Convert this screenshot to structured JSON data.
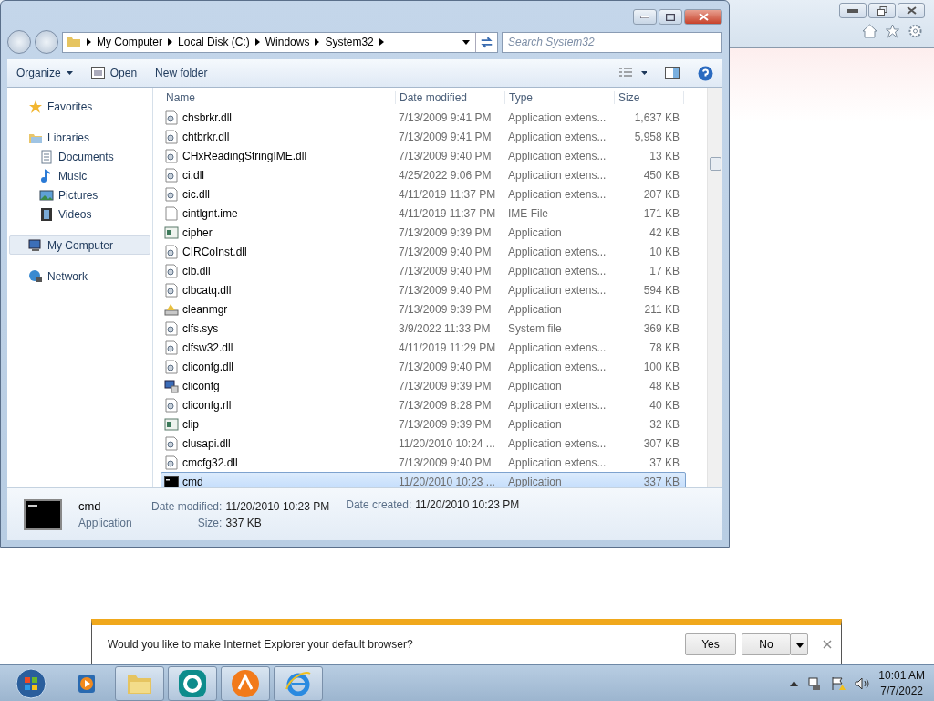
{
  "explorer": {
    "breadcrumbs": [
      "My Computer",
      "Local Disk (C:)",
      "Windows",
      "System32"
    ],
    "search": {
      "placeholder": "Search System32"
    },
    "toolbar": [
      {
        "label": "Organize",
        "kind": "menu"
      },
      {
        "label": "Open",
        "kind": "open"
      },
      {
        "label": "New folder",
        "kind": "plain"
      }
    ],
    "nav": [
      {
        "label": "Favorites",
        "kind": "star",
        "selected": false
      },
      {
        "label": "Libraries",
        "kind": "library",
        "selected": false,
        "children": [
          {
            "label": "Documents",
            "kind": "document",
            "selected": false
          },
          {
            "label": "Music",
            "kind": "music",
            "selected": false
          },
          {
            "label": "Pictures",
            "kind": "pictures",
            "selected": false
          },
          {
            "label": "Videos",
            "kind": "videos",
            "selected": false
          }
        ]
      },
      {
        "label": "My Computer",
        "kind": "computer",
        "selected": true
      },
      {
        "label": "Network",
        "kind": "network",
        "selected": false
      }
    ],
    "columns": [
      "Name",
      "Date modified",
      "Type",
      "Size"
    ],
    "rows": [
      {
        "name": "chsbrkr.dll",
        "date": "7/13/2009 9:41 PM",
        "type": "Application extens...",
        "size": "1,637 KB",
        "kind": "dll",
        "selected": false
      },
      {
        "name": "chtbrkr.dll",
        "date": "7/13/2009 9:41 PM",
        "type": "Application extens...",
        "size": "5,958 KB",
        "kind": "dll",
        "selected": false
      },
      {
        "name": "CHxReadingStringIME.dll",
        "date": "7/13/2009 9:40 PM",
        "type": "Application extens...",
        "size": "13 KB",
        "kind": "dll",
        "selected": false
      },
      {
        "name": "ci.dll",
        "date": "4/25/2022 9:06 PM",
        "type": "Application extens...",
        "size": "450 KB",
        "kind": "dll",
        "selected": false
      },
      {
        "name": "cic.dll",
        "date": "4/11/2019 11:37 PM",
        "type": "Application extens...",
        "size": "207 KB",
        "kind": "dll",
        "selected": false
      },
      {
        "name": "cintlgnt.ime",
        "date": "4/11/2019 11:37 PM",
        "type": "IME File",
        "size": "171 KB",
        "kind": "file",
        "selected": false
      },
      {
        "name": "cipher",
        "date": "7/13/2009 9:39 PM",
        "type": "Application",
        "size": "42 KB",
        "kind": "app",
        "selected": false
      },
      {
        "name": "CIRCoInst.dll",
        "date": "7/13/2009 9:40 PM",
        "type": "Application extens...",
        "size": "10 KB",
        "kind": "dll",
        "selected": false
      },
      {
        "name": "clb.dll",
        "date": "7/13/2009 9:40 PM",
        "type": "Application extens...",
        "size": "17 KB",
        "kind": "dll",
        "selected": false
      },
      {
        "name": "clbcatq.dll",
        "date": "7/13/2009 9:40 PM",
        "type": "Application extens...",
        "size": "594 KB",
        "kind": "dll",
        "selected": false
      },
      {
        "name": "cleanmgr",
        "date": "7/13/2009 9:39 PM",
        "type": "Application",
        "size": "211 KB",
        "kind": "cleaner",
        "selected": false
      },
      {
        "name": "clfs.sys",
        "date": "3/9/2022 11:33 PM",
        "type": "System file",
        "size": "369 KB",
        "kind": "dll",
        "selected": false
      },
      {
        "name": "clfsw32.dll",
        "date": "4/11/2019 11:29 PM",
        "type": "Application extens...",
        "size": "78 KB",
        "kind": "dll",
        "selected": false
      },
      {
        "name": "cliconfg.dll",
        "date": "7/13/2009 9:40 PM",
        "type": "Application extens...",
        "size": "100 KB",
        "kind": "dll",
        "selected": false
      },
      {
        "name": "cliconfg",
        "date": "7/13/2009 9:39 PM",
        "type": "Application",
        "size": "48 KB",
        "kind": "config",
        "selected": false
      },
      {
        "name": "cliconfg.rll",
        "date": "7/13/2009 8:28 PM",
        "type": "Application extens...",
        "size": "40 KB",
        "kind": "dll",
        "selected": false
      },
      {
        "name": "clip",
        "date": "7/13/2009 9:39 PM",
        "type": "Application",
        "size": "32 KB",
        "kind": "app",
        "selected": false
      },
      {
        "name": "clusapi.dll",
        "date": "11/20/2010 10:24 ...",
        "type": "Application extens...",
        "size": "307 KB",
        "kind": "dll",
        "selected": false
      },
      {
        "name": "cmcfg32.dll",
        "date": "7/13/2009 9:40 PM",
        "type": "Application extens...",
        "size": "37 KB",
        "kind": "dll",
        "selected": false
      },
      {
        "name": "cmd",
        "date": "11/20/2010 10:23 ...",
        "type": "Application",
        "size": "337 KB",
        "kind": "console",
        "selected": true
      }
    ],
    "details": {
      "name": "cmd",
      "type": "Application",
      "fields": [
        {
          "label": "Date modified:",
          "value": "11/20/2010 10:23 PM"
        },
        {
          "label": "Size:",
          "value": "337 KB"
        },
        {
          "label": "Date created:",
          "value": "11/20/2010 10:23 PM"
        }
      ]
    }
  },
  "notification": {
    "message": "Would you like to make Internet Explorer your default browser?",
    "buttons": [
      "Yes",
      "No"
    ]
  },
  "taskbar": {
    "items": [
      {
        "kind": "media"
      },
      {
        "kind": "folder"
      },
      {
        "kind": "security"
      },
      {
        "kind": "orange"
      },
      {
        "kind": "ie"
      }
    ],
    "time": "10:01 AM",
    "date": "7/7/2022"
  }
}
